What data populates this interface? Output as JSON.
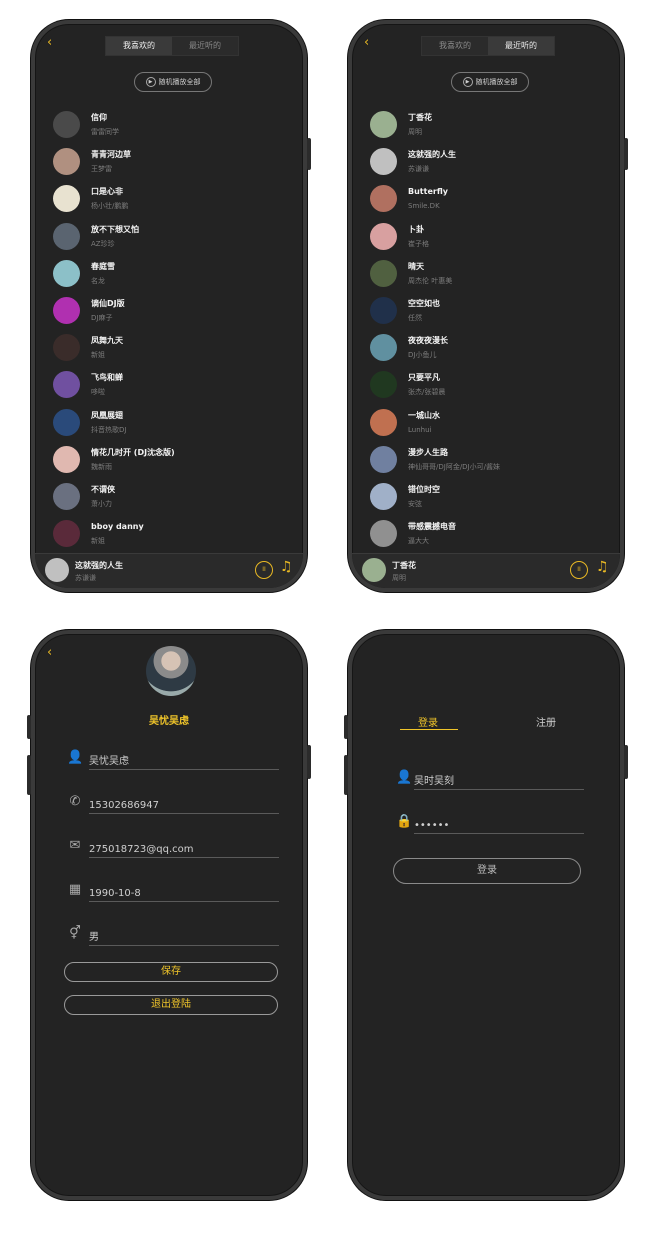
{
  "tabs": {
    "favorites": "我喜欢的",
    "recent": "最近听的"
  },
  "shuffle_label": "随机播放全部",
  "favorites": [
    {
      "title": "信仰",
      "artist": "雷雷同学",
      "color": "#4a4a4a"
    },
    {
      "title": "青青河边草",
      "artist": "王梦雷",
      "color": "#b09080"
    },
    {
      "title": "口是心非",
      "artist": "杨小壮/鹏鹏",
      "color": "#e8e2d0"
    },
    {
      "title": "放不下想又怕",
      "artist": "AZ珍珍",
      "color": "#5a6470"
    },
    {
      "title": "春庭雪",
      "artist": "名龙",
      "color": "#8cc0c8"
    },
    {
      "title": "谪仙DJ版",
      "artist": "DJ麻子",
      "color": "#b030b0"
    },
    {
      "title": "凤舞九天",
      "artist": "新姐",
      "color": "#3a2c2a"
    },
    {
      "title": "飞鸟和蝉",
      "artist": "哆啦",
      "color": "#7050a0"
    },
    {
      "title": "凤凰展翅",
      "artist": "抖音热歌DJ",
      "color": "#2a4a7a"
    },
    {
      "title": "情花几时开 (DJ沈念版)",
      "artist": "魏新雨",
      "color": "#e0b8b0"
    },
    {
      "title": "不谓侠",
      "artist": "萧小力",
      "color": "#6a7080"
    },
    {
      "title": "bboy danny",
      "artist": "新姐",
      "color": "#5a2a3a"
    }
  ],
  "recent": [
    {
      "title": "丁香花",
      "artist": "周明",
      "color": "#9ab090"
    },
    {
      "title": "这就强的人生",
      "artist": "苏谦谦",
      "color": "#c0c0c0"
    },
    {
      "title": "Butterfly",
      "artist": "Smile.DK",
      "color": "#b07060"
    },
    {
      "title": "卜卦",
      "artist": "崔子格",
      "color": "#d8a0a0"
    },
    {
      "title": "晴天",
      "artist": "周杰伦 叶惠美",
      "color": "#506040"
    },
    {
      "title": "空空如也",
      "artist": "任然",
      "color": "#20304a"
    },
    {
      "title": "夜夜夜漫长",
      "artist": "DJ小鱼儿",
      "color": "#6090a0"
    },
    {
      "title": "只要平凡",
      "artist": "张杰/张碧晨",
      "color": "#203820"
    },
    {
      "title": "一城山水",
      "artist": "Lunhui",
      "color": "#c07050"
    },
    {
      "title": "漫步人生路",
      "artist": "神仙哥哥/DJ阿金/DJ小可/酱妹",
      "color": "#7080a0"
    },
    {
      "title": "错位时空",
      "artist": "安弦",
      "color": "#a0b0c8"
    },
    {
      "title": "带感震撼电音",
      "artist": "逼大大",
      "color": "#909090"
    }
  ],
  "player1": {
    "title": "这就强的人生",
    "artist": "苏谦谦"
  },
  "player2": {
    "title": "丁香花",
    "artist": "周明"
  },
  "profile": {
    "name": "吴忧吴虑",
    "username": "吴忧吴虑",
    "phone": "15302686947",
    "email": "275018723@qq.com",
    "birthday": "1990-10-8",
    "gender": "男",
    "save": "保存",
    "logout": "退出登陆"
  },
  "login": {
    "tab_login": "登录",
    "tab_register": "注册",
    "username": "吴时吴刻",
    "password": "••••••",
    "submit": "登录"
  },
  "colors": {
    "accent": "#f0c52a",
    "bg": "#232323"
  }
}
